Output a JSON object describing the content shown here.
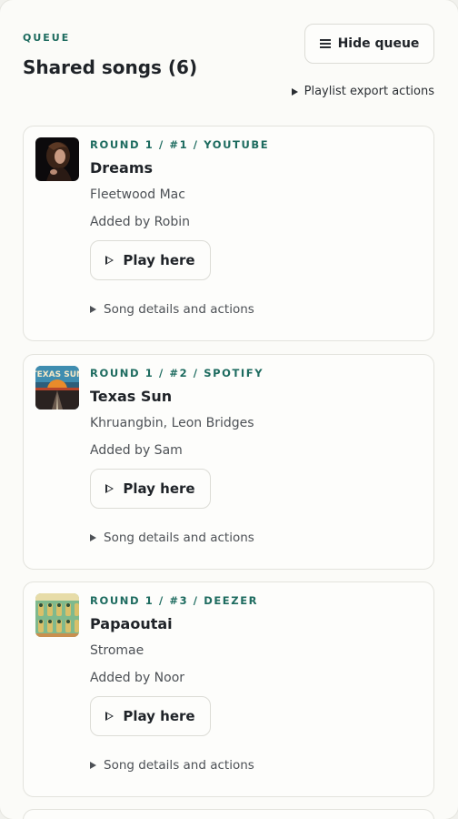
{
  "header": {
    "eyebrow": "QUEUE",
    "title": "Shared songs (6)",
    "hide_label": "Hide queue",
    "export_label": "Playlist export actions"
  },
  "songs": [
    {
      "meta": "ROUND 1 / #1 / YOUTUBE",
      "title": "Dreams",
      "artist": "Fleetwood Mac",
      "added": "Added by Robin",
      "play_label": "Play here",
      "details_label": "Song details and actions"
    },
    {
      "meta": "ROUND 1 / #2 / SPOTIFY",
      "title": "Texas Sun",
      "artist": "Khruangbin, Leon Bridges",
      "added": "Added by Sam",
      "play_label": "Play here",
      "details_label": "Song details and actions"
    },
    {
      "meta": "ROUND 1 / #3 / DEEZER",
      "title": "Papaoutai",
      "artist": "Stromae",
      "added": "Added by Noor",
      "play_label": "Play here",
      "details_label": "Song details and actions"
    }
  ],
  "art": {
    "texas_sun_text": "TEXAS SUN"
  },
  "colors": {
    "accent": "#1d6b5f",
    "text": "#1f2328",
    "muted": "#4d5156",
    "border": "#e3e3dd"
  }
}
